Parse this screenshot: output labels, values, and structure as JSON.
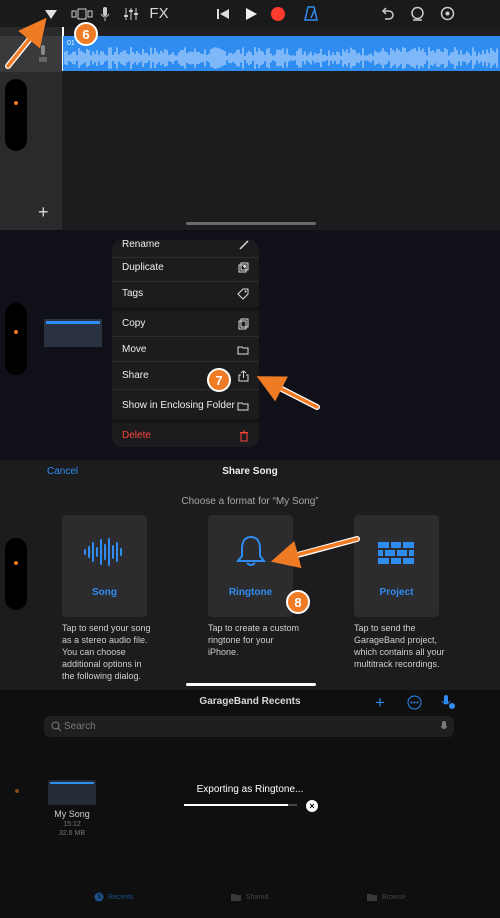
{
  "toolbar": {
    "fx_label": "FX",
    "icons": [
      "browser-dropdown-icon",
      "tracks-view-icon",
      "microphone-icon",
      "mixer-icon",
      "rewind-icon",
      "play-icon",
      "record-icon",
      "metronome-icon",
      "undo-icon",
      "loop-icon",
      "settings-icon"
    ]
  },
  "timeline": {
    "region_label": "01"
  },
  "badges": {
    "step6": "6",
    "step7": "7",
    "step8": "8"
  },
  "context_menu": {
    "items": [
      {
        "label": "Rename",
        "icon": "pencil-icon"
      },
      {
        "label": "Duplicate",
        "icon": "duplicate-icon"
      },
      {
        "label": "Tags",
        "icon": "tag-icon"
      },
      {
        "label": "Copy",
        "icon": "copy-icon"
      },
      {
        "label": "Move",
        "icon": "folder-icon"
      },
      {
        "label": "Share",
        "icon": "share-icon"
      },
      {
        "label": "Show in Enclosing Folder",
        "icon": "folder-icon"
      },
      {
        "label": "Delete",
        "icon": "trash-icon"
      }
    ]
  },
  "share_sheet": {
    "cancel": "Cancel",
    "title": "Share Song",
    "prompt": "Choose a format for “My Song”",
    "options": [
      {
        "label": "Song",
        "description": "Tap to send your song as a stereo audio file. You can choose additional options in the following dialog."
      },
      {
        "label": "Ringtone",
        "description": "Tap to create a custom ringtone for your iPhone."
      },
      {
        "label": "Project",
        "description": "Tap to send the GarageBand project, which contains all your multitrack recordings."
      }
    ]
  },
  "recents": {
    "title": "GarageBand Recents",
    "search_placeholder": "Search",
    "file": {
      "name": "My Song",
      "time": "15:12",
      "size": "32.6 MB"
    },
    "export_status": "Exporting as Ringtone...",
    "export_progress": 0.92,
    "tabs": [
      {
        "label": "Recents"
      },
      {
        "label": "Shared"
      },
      {
        "label": "Browse"
      }
    ]
  },
  "colors": {
    "accent": "#2f8cf0",
    "record": "#ff3b30",
    "annotation": "#f07b25",
    "delete": "#ff453a"
  }
}
